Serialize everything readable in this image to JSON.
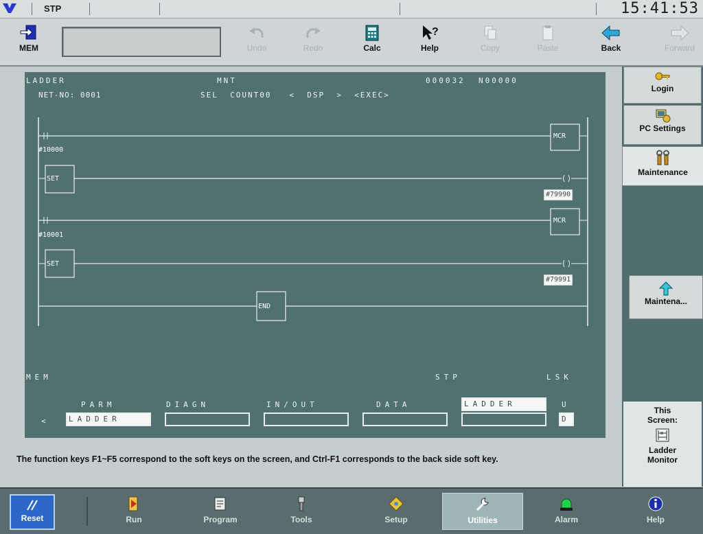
{
  "statusbar": {
    "mode": "STP",
    "clock": "15:41:53"
  },
  "toolbar": {
    "mem": "MEM",
    "undo": "Undo",
    "redo": "Redo",
    "calc": "Calc",
    "help": "Help",
    "copy": "Copy",
    "paste": "Paste",
    "back": "Back",
    "forward": "Forward"
  },
  "right_panel": {
    "login": "Login",
    "pc_settings": "PC Settings",
    "maintenance": "Maintenance",
    "maintena_button": "Maintena...",
    "this_screen_1": "This",
    "this_screen_2": "Screen:",
    "screen_name_1": "Ladder",
    "screen_name_2": "Monitor"
  },
  "ladder": {
    "header_title": "LADDER",
    "header_mode": "MNT",
    "header_counter": "000032  N00000",
    "netno": "NET-NO: 0001",
    "sel_line": "SEL  COUNT00   <  DSP  >  <EXEC>",
    "rung1_contact": "#10000",
    "rung1_coil": "MCR",
    "rung2_block": "SET",
    "rung2_output": "#79990",
    "rung3_contact": "#10001",
    "rung3_coil": "MCR",
    "rung4_block": "SET",
    "rung4_output": "#79991",
    "end_block": "END",
    "footer_left": "MEM",
    "footer_mid": "STP",
    "footer_right": "LSK",
    "softkeys": {
      "arrow": "<",
      "k1_top": "PARM",
      "k1_box": "LADDER",
      "k2_top": "DIAGN",
      "k3_top": "IN/OUT",
      "k4_top": "DATA",
      "k5_top": "LADDER",
      "k6_top": "U",
      "k6_box": "D"
    }
  },
  "info_text": "The function keys F1~F5 correspond to the soft keys on the screen, and Ctrl-F1 corresponds to the back side soft key.",
  "bottom_nav": {
    "reset": "Reset",
    "run": "Run",
    "program": "Program",
    "tools": "Tools",
    "setup": "Setup",
    "utilities": "Utilities",
    "alarm": "Alarm",
    "help": "Help"
  }
}
